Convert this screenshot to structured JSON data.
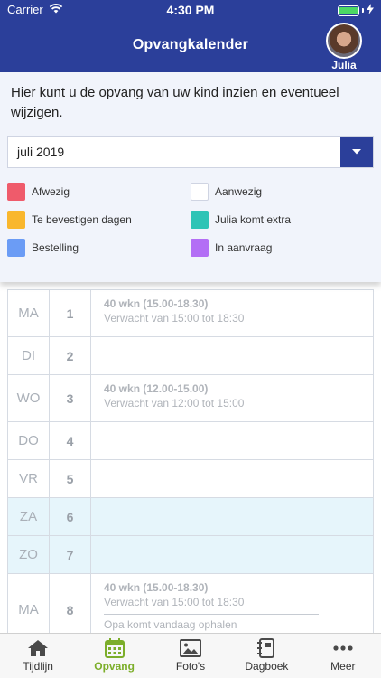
{
  "status_bar": {
    "carrier": "Carrier",
    "time": "4:30 PM"
  },
  "header": {
    "title": "Opvangkalender",
    "avatar_name": "Julia"
  },
  "intro_text": "Hier kunt u de opvang van uw kind inzien en eventueel wijzigen.",
  "month_select": {
    "value": "juli 2019"
  },
  "legend": {
    "left": [
      {
        "label": "Afwezig",
        "color": "#ef5b6b"
      },
      {
        "label": "Te bevestigen dagen",
        "color": "#f9b72d"
      },
      {
        "label": "Bestelling",
        "color": "#6b9cf5"
      }
    ],
    "right": [
      {
        "label": "Aanwezig",
        "color": "#ffffff"
      },
      {
        "label": "Julia komt extra",
        "color": "#2ec4b6"
      },
      {
        "label": "In aanvraag",
        "color": "#b36ef5"
      }
    ]
  },
  "calendar": {
    "rows": [
      {
        "day": "MA",
        "num": "1",
        "title": "40 wkn (15.00-18.30)",
        "subtitle": "Verwacht van 15:00 tot 18:30"
      },
      {
        "day": "DI",
        "num": "2"
      },
      {
        "day": "WO",
        "num": "3",
        "title": "40 wkn (12.00-15.00)",
        "subtitle": "Verwacht van 12:00 tot 15:00"
      },
      {
        "day": "DO",
        "num": "4"
      },
      {
        "day": "VR",
        "num": "5"
      },
      {
        "day": "ZA",
        "num": "6"
      },
      {
        "day": "ZO",
        "num": "7"
      },
      {
        "day": "MA",
        "num": "8",
        "title": "40 wkn (15.00-18.30)",
        "subtitle": "Verwacht van 15:00 tot 18:30",
        "note": "Opa komt vandaag ophalen"
      }
    ]
  },
  "tabs": [
    {
      "label": "Tijdlijn",
      "icon": "home-icon"
    },
    {
      "label": "Opvang",
      "icon": "calendar-icon"
    },
    {
      "label": "Foto's",
      "icon": "photo-icon"
    },
    {
      "label": "Dagboek",
      "icon": "notebook-icon"
    },
    {
      "label": "Meer",
      "icon": "more-icon"
    }
  ],
  "colors": {
    "primary": "#2b3f9a",
    "active_tab": "#7cae2a",
    "weekend": "#e6f5fb"
  }
}
